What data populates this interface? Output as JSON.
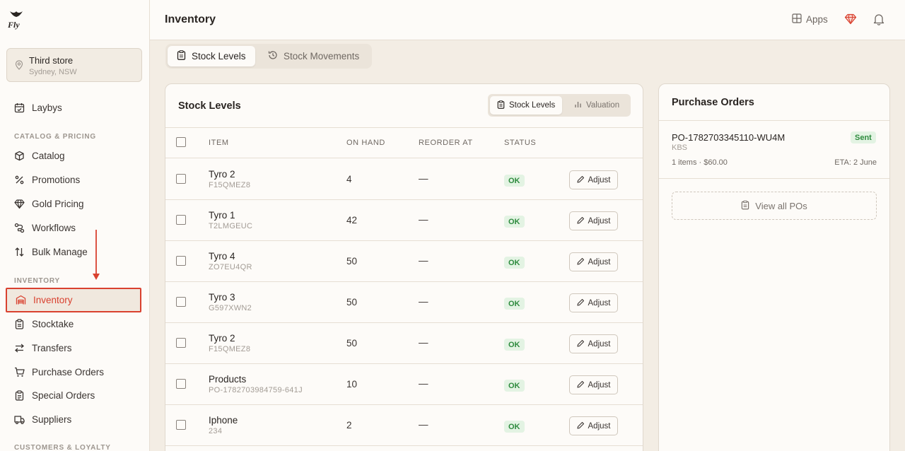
{
  "app": {
    "logo_text": "Fly"
  },
  "store": {
    "name": "Third store",
    "location": "Sydney, NSW"
  },
  "sidebar": {
    "top_items": [
      {
        "label": "Laybys",
        "icon": "calendar-check-icon"
      }
    ],
    "sections": [
      {
        "title": "CATALOG & PRICING",
        "items": [
          {
            "label": "Catalog",
            "icon": "box-icon"
          },
          {
            "label": "Promotions",
            "icon": "percent-icon"
          },
          {
            "label": "Gold Pricing",
            "icon": "gem-icon"
          },
          {
            "label": "Workflows",
            "icon": "workflow-icon"
          },
          {
            "label": "Bulk Manage",
            "icon": "arrows-up-down-icon"
          }
        ]
      },
      {
        "title": "INVENTORY",
        "items": [
          {
            "label": "Inventory",
            "icon": "warehouse-icon",
            "active": true
          },
          {
            "label": "Stocktake",
            "icon": "clipboard-icon"
          },
          {
            "label": "Transfers",
            "icon": "transfer-icon"
          },
          {
            "label": "Purchase Orders",
            "icon": "cart-icon"
          },
          {
            "label": "Special Orders",
            "icon": "clipboard-list-icon"
          },
          {
            "label": "Suppliers",
            "icon": "truck-icon"
          }
        ]
      },
      {
        "title": "CUSTOMERS & LOYALTY",
        "items": []
      }
    ]
  },
  "header": {
    "title": "Inventory",
    "apps_label": "Apps"
  },
  "tabs": [
    {
      "label": "Stock Levels",
      "active": true
    },
    {
      "label": "Stock Movements",
      "active": false
    }
  ],
  "stock_panel": {
    "title": "Stock Levels",
    "segments": [
      {
        "label": "Stock Levels",
        "active": true
      },
      {
        "label": "Valuation",
        "active": false
      }
    ],
    "columns": [
      "ITEM",
      "ON HAND",
      "REORDER AT",
      "STATUS"
    ],
    "adjust_label": "Adjust",
    "rows": [
      {
        "name": "Tyro 2",
        "sku": "F15QMEZ8",
        "on_hand": "4",
        "reorder": "—",
        "status": "OK"
      },
      {
        "name": "Tyro 1",
        "sku": "T2LMGEUC",
        "on_hand": "42",
        "reorder": "—",
        "status": "OK"
      },
      {
        "name": "Tyro 4",
        "sku": "ZO7EU4QR",
        "on_hand": "50",
        "reorder": "—",
        "status": "OK"
      },
      {
        "name": "Tyro 3",
        "sku": "G597XWN2",
        "on_hand": "50",
        "reorder": "—",
        "status": "OK"
      },
      {
        "name": "Tyro 2",
        "sku": "F15QMEZ8",
        "on_hand": "50",
        "reorder": "—",
        "status": "OK"
      },
      {
        "name": "Products",
        "sku": "PO-1782703984759-641J",
        "on_hand": "10",
        "reorder": "—",
        "status": "OK"
      },
      {
        "name": "Iphone",
        "sku": "234",
        "on_hand": "2",
        "reorder": "—",
        "status": "OK"
      }
    ]
  },
  "purchase_orders": {
    "title": "Purchase Orders",
    "order": {
      "number": "PO-1782703345110-WU4M",
      "status": "Sent",
      "supplier": "KBS",
      "summary": "1 items · $60.00",
      "eta": "ETA: 2 June"
    },
    "view_all_label": "View all POs"
  },
  "colors": {
    "accent_red": "#d9412f",
    "status_green": "#2e8b3e",
    "status_green_bg": "#e3f3e3"
  }
}
